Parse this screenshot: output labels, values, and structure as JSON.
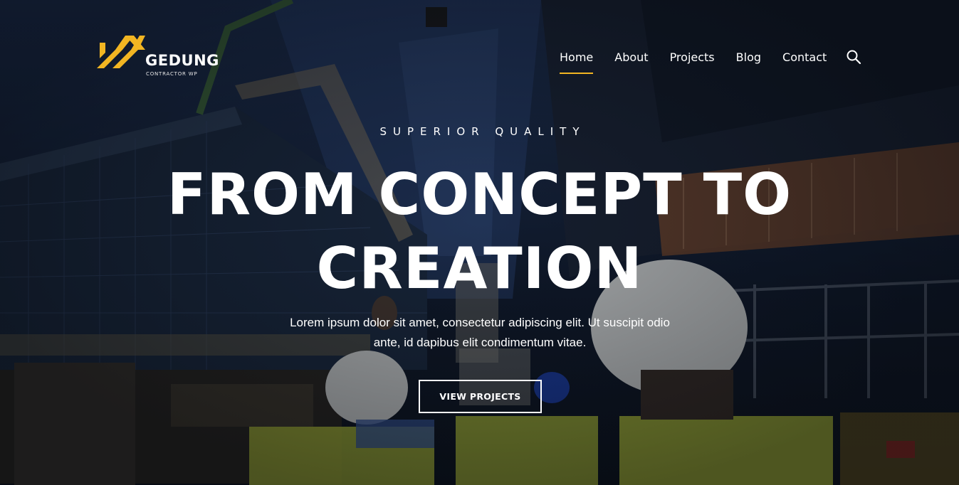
{
  "brand": {
    "name": "GEDUNG",
    "tagline": "CONTRACTOR WP",
    "logo_icon": "roof-chevron-icon",
    "accent_color": "#f2b522"
  },
  "nav": {
    "items": [
      {
        "label": "Home",
        "active": true
      },
      {
        "label": "About",
        "active": false
      },
      {
        "label": "Projects",
        "active": false
      },
      {
        "label": "Blog",
        "active": false
      },
      {
        "label": "Contact",
        "active": false
      }
    ],
    "search_icon": "search-icon"
  },
  "hero": {
    "eyebrow": "SUPERIOR QUALITY",
    "headline_line1": "FROM CONCEPT TO",
    "headline_line2": "CREATION",
    "lead_line1": "Lorem ipsum dolor sit amet, consectetur adipiscing elit. Ut suscipit odio",
    "lead_line2": "ante, id dapibus elit condimentum vitae.",
    "cta_label": "VIEW PROJECTS"
  }
}
